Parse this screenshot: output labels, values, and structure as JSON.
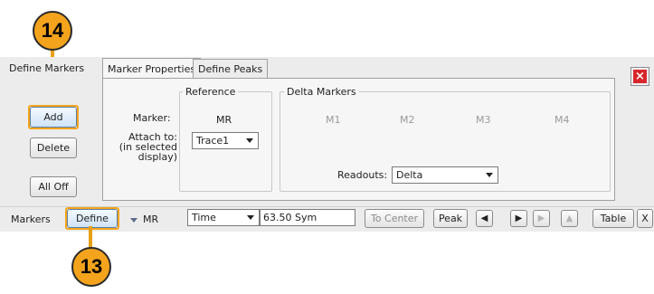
{
  "callouts": {
    "top": "14",
    "bottom": "13"
  },
  "panel": {
    "title": "Define Markers",
    "tabs": [
      {
        "label": "Marker Properties"
      },
      {
        "label": "Define Peaks"
      }
    ],
    "buttons": {
      "add": "Add",
      "delete": "Delete",
      "all_off": "All Off"
    },
    "reference": {
      "group_title": "Reference",
      "marker_label": "Marker:",
      "marker_value": "MR",
      "attach_label": "Attach to:\n(in selected\ndisplay)",
      "attach_value": "Trace1"
    },
    "delta": {
      "group_title": "Delta Markers",
      "markers": [
        "M1",
        "M2",
        "M3",
        "M4"
      ],
      "readouts_label": "Readouts:",
      "readouts_value": "Delta"
    },
    "close_symbol": "×"
  },
  "toolbar": {
    "markers_label": "Markers",
    "define_label": "Define",
    "marker_select": "MR",
    "mode_select": "Time",
    "value_input": "63.50 Sym",
    "to_center": "To Center",
    "peak": "Peak",
    "arrows": [
      "◀",
      "▶",
      "▶",
      "▲"
    ],
    "table": "Table",
    "x_button": "X"
  }
}
